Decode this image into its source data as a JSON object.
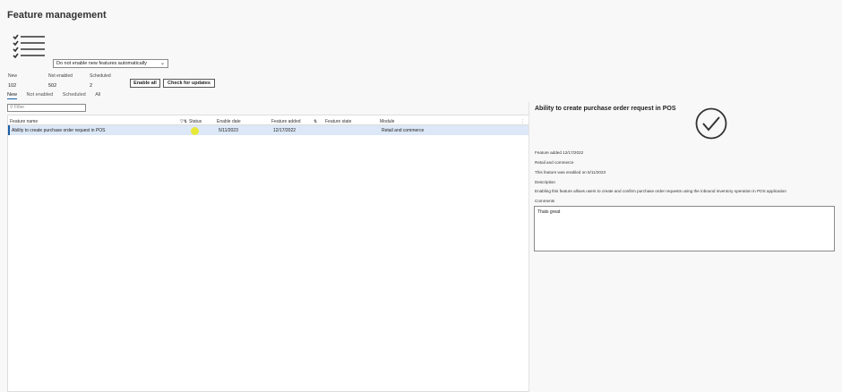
{
  "page": {
    "title": "Feature management"
  },
  "auto_enable": {
    "selected": "Do not enable new features automatically"
  },
  "stats": [
    {
      "label": "New",
      "value": "102"
    },
    {
      "label": "Not enabled",
      "value": "502"
    },
    {
      "label": "Scheduled",
      "value": "2"
    }
  ],
  "actions": {
    "enable_all": "Enable all",
    "check_updates": "Check for updates"
  },
  "tabs": [
    "New",
    "Not enabled",
    "Scheduled",
    "All"
  ],
  "filter": {
    "placeholder": "Filter"
  },
  "grid": {
    "columns": [
      "Feature name",
      "Status",
      "Enable date",
      "Feature added",
      "Feature state",
      "Module"
    ],
    "rows": [
      {
        "feature_name": "Ability to create purchase order request in POS",
        "status": "",
        "enable_date": "5/11/2023",
        "feature_added": "12/17/2022",
        "feature_state": "",
        "module": "Retail and commerce"
      }
    ]
  },
  "detail": {
    "title": "Ability to create purchase order request in POS",
    "feature_added": "Feature added 12/17/2022",
    "module": "Retail and commerce",
    "enabled_on": "This feature was enabled on 5/11/2023",
    "description_label": "Description",
    "description": "Enabling this feature allows users to create and confirm purchase order requests using the inbound inventory operation in POS application",
    "comments_label": "Comments",
    "comments": "Thats great"
  },
  "colors": {
    "accent": "#1a5ea8",
    "selected_row": "#dce8f7",
    "status_highlight": "#e8e83a"
  },
  "icons": {
    "header": "checklist-icon",
    "detail": "check-circle-icon",
    "filter": "search-icon",
    "dropdown": "chevron-down-icon"
  }
}
